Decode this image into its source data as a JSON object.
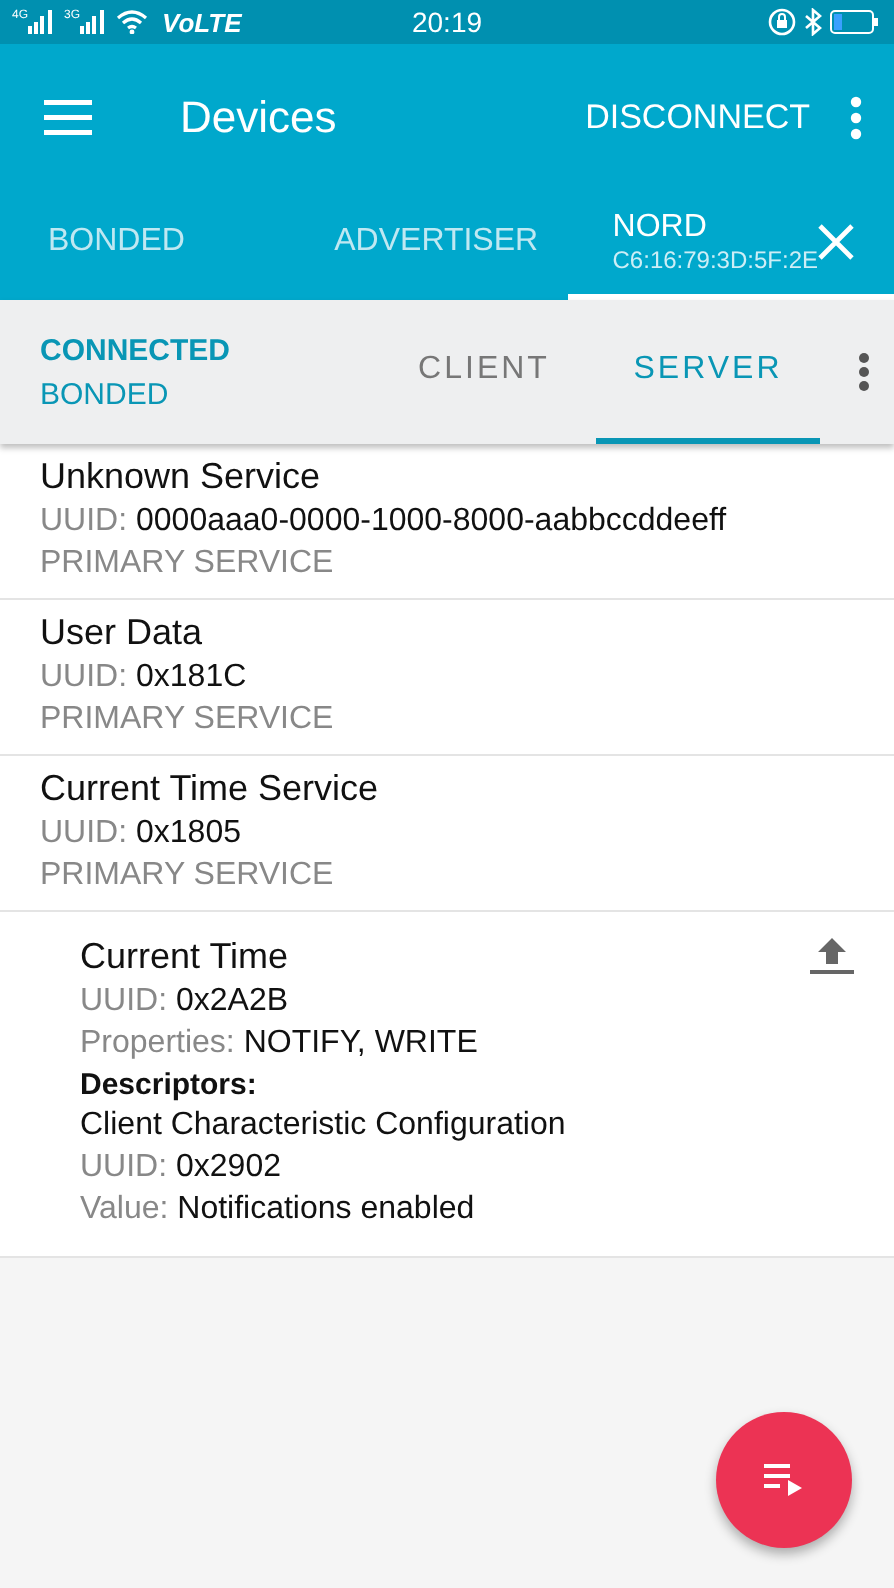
{
  "status_bar": {
    "network_labels": [
      "4G",
      "3G"
    ],
    "carrier_label": "VoLTE",
    "time": "20:19"
  },
  "app_bar": {
    "title": "Devices",
    "action": "DISCONNECT"
  },
  "device_tabs": [
    {
      "label": "BONDED",
      "selected": false
    },
    {
      "label": "ADVERTISER",
      "selected": false
    },
    {
      "label": "NORD",
      "subtitle": "C6:16:79:3D:5F:2E",
      "selected": true,
      "closable": true
    }
  ],
  "connection": {
    "state": "CONNECTED",
    "bond": "BONDED"
  },
  "view_tabs": [
    {
      "label": "CLIENT",
      "selected": false
    },
    {
      "label": "SERVER",
      "selected": true
    }
  ],
  "services": [
    {
      "name": "Unknown Service",
      "uuid_label": "UUID:",
      "uuid": "0000aaa0-0000-1000-8000-aabbccddeeff",
      "type": "PRIMARY SERVICE"
    },
    {
      "name": "User Data",
      "uuid_label": "UUID:",
      "uuid": "0x181C",
      "type": "PRIMARY SERVICE"
    },
    {
      "name": "Current Time Service",
      "uuid_label": "UUID:",
      "uuid": "0x1805",
      "type": "PRIMARY SERVICE",
      "children": [
        {
          "name": "Current Time",
          "uuid_label": "UUID:",
          "uuid": "0x2A2B",
          "properties_label": "Properties:",
          "properties": "NOTIFY, WRITE",
          "descriptors_heading": "Descriptors:",
          "descriptors": [
            {
              "name": "Client Characteristic Configuration",
              "uuid_label": "UUID:",
              "uuid": "0x2902",
              "value_label": "Value:",
              "value": "Notifications enabled"
            }
          ]
        }
      ]
    }
  ]
}
